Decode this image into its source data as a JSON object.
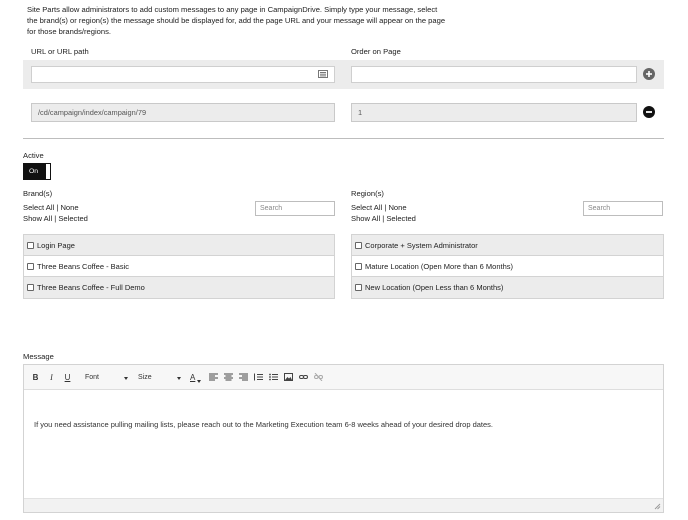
{
  "intro": "Site Parts allow administrators to add custom messages to any page in CampaignDrive. Simply type your message, select the brand(s) or region(s) the message should be displayed for, add the page URL and your message will appear on the page for those brands/regions.",
  "url_section": {
    "url_label": "URL or URL path",
    "order_label": "Order on Page",
    "new_url_value": "",
    "new_order_value": "",
    "rows": [
      {
        "url": "/cd/campaign/index/campaign/79",
        "order": "1"
      }
    ]
  },
  "active": {
    "label": "Active",
    "toggle_label": "On",
    "value": true
  },
  "brands": {
    "label": "Brand(s)",
    "select_all": "Select All",
    "none": "None",
    "show_all": "Show All",
    "selected": "Selected",
    "search_placeholder": "Search",
    "items": [
      {
        "label": "Login Page",
        "checked": false
      },
      {
        "label": "Three Beans Coffee - Basic",
        "checked": false
      },
      {
        "label": "Three Beans Coffee - Full Demo",
        "checked": false
      }
    ]
  },
  "regions": {
    "label": "Region(s)",
    "select_all": "Select All",
    "none": "None",
    "show_all": "Show All",
    "selected": "Selected",
    "search_placeholder": "Search",
    "items": [
      {
        "label": "Corporate + System Administrator",
        "checked": false
      },
      {
        "label": "Mature Location (Open More than 6 Months)",
        "checked": false
      },
      {
        "label": "New Location (Open Less than 6 Months)",
        "checked": false
      }
    ]
  },
  "message": {
    "label": "Message",
    "toolbar": {
      "bold": "B",
      "italic": "I",
      "underline": "U",
      "font": "Font",
      "size": "Size",
      "text_color": "A"
    },
    "body": "If you need assistance pulling mailing lists, please reach out to the Marketing Execution team 6-8 weeks ahead of your desired drop dates."
  },
  "colors": {
    "band": "#ececec",
    "toggle": "#111111",
    "plus_button": "#666666",
    "minus_button": "#111111"
  }
}
